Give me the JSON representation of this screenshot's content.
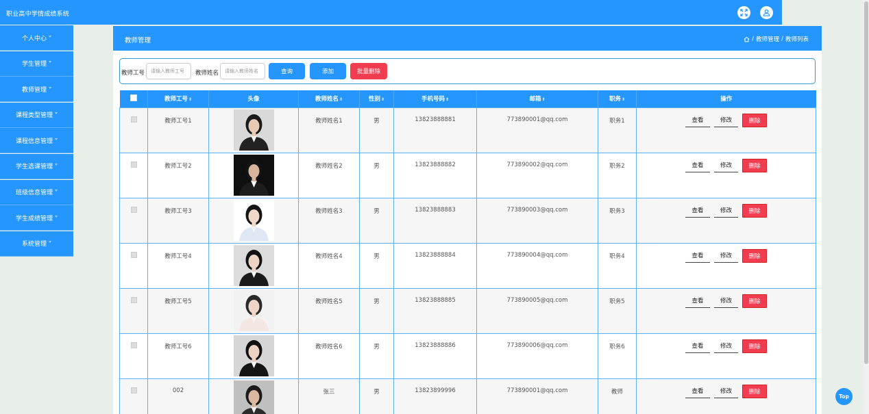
{
  "app": {
    "title": "职业高中学情成绩系统"
  },
  "sidebar": {
    "items": [
      {
        "label": "个人中心"
      },
      {
        "label": "学生管理"
      },
      {
        "label": "教师管理"
      },
      {
        "label": "课程类型管理"
      },
      {
        "label": "课程信息管理"
      },
      {
        "label": "学生选课管理"
      },
      {
        "label": "班级信息管理"
      },
      {
        "label": "学生成绩管理"
      },
      {
        "label": "系统管理"
      }
    ]
  },
  "page": {
    "title": "教师管理",
    "breadcrumb": [
      "教师管理",
      "教师列表"
    ],
    "breadcrumb_sep": "/"
  },
  "search": {
    "teacher_no_label": "教师工号",
    "teacher_no_placeholder": "请输入教师工号",
    "teacher_name_label": "教师姓名",
    "teacher_name_placeholder": "请输入教师姓名",
    "query_label": "查询",
    "add_label": "添加",
    "batch_delete_label": "批量删除"
  },
  "table": {
    "headers": [
      "",
      "教师工号",
      "头像",
      "教师姓名",
      "性别",
      "手机号码",
      "邮箱",
      "职务",
      "操作"
    ],
    "sortable": [
      false,
      true,
      false,
      true,
      true,
      true,
      true,
      true,
      false
    ],
    "sort_glyph": "⇕",
    "rows": [
      {
        "no": "教师工号1",
        "name": "教师姓名1",
        "gender": "男",
        "phone": "13823888881",
        "email": "773890001@qq.com",
        "duty": "职务1",
        "avatar": {
          "bg": "#d9d9d9",
          "suit": "#222222",
          "hair": "#1a1a1a",
          "skin": "#e8c9b4"
        }
      },
      {
        "no": "教师工号2",
        "name": "教师姓名2",
        "gender": "男",
        "phone": "13823888882",
        "email": "773890002@qq.com",
        "duty": "职务2",
        "avatar": {
          "bg": "#0f0f0f",
          "suit": "#1c1c1c",
          "hair": "#141414",
          "skin": "#d8b59c"
        }
      },
      {
        "no": "教师工号3",
        "name": "教师姓名3",
        "gender": "男",
        "phone": "13823888883",
        "email": "773890003@qq.com",
        "duty": "职务3",
        "avatar": {
          "bg": "#ffffff",
          "suit": "#dfe7f5",
          "hair": "#151515",
          "skin": "#f1d8c8"
        }
      },
      {
        "no": "教师工号4",
        "name": "教师姓名4",
        "gender": "男",
        "phone": "13823888884",
        "email": "773890004@qq.com",
        "duty": "职务4",
        "avatar": {
          "bg": "#dcdcdc",
          "suit": "#1a1a1a",
          "hair": "#111111",
          "skin": "#ecd3c3"
        }
      },
      {
        "no": "教师工号5",
        "name": "教师姓名5",
        "gender": "男",
        "phone": "13823888885",
        "email": "773890005@qq.com",
        "duty": "职务5",
        "avatar": {
          "bg": "#f2f2f2",
          "suit": "#f3e6e3",
          "hair": "#2a2a2a",
          "skin": "#efd6c8"
        }
      },
      {
        "no": "教师工号6",
        "name": "教师姓名6",
        "gender": "男",
        "phone": "13823888886",
        "email": "773890006@qq.com",
        "duty": "职务6",
        "avatar": {
          "bg": "#d6d6d6",
          "suit": "#151515",
          "hair": "#101010",
          "skin": "#ecd2c1"
        }
      },
      {
        "no": "002",
        "name": "张三",
        "gender": "男",
        "phone": "13823899996",
        "email": "773890001@qq.com",
        "duty": "教师",
        "avatar": {
          "bg": "#bfbfbf",
          "suit": "#2b2b2b",
          "hair": "#1b1b1b",
          "skin": "#dcb8a0"
        }
      }
    ],
    "actions": {
      "view": "查看",
      "edit": "修改",
      "delete": "删除"
    }
  },
  "back_to_top": "Top",
  "colors": {
    "primary": "#2596fd",
    "danger": "#f23c4f",
    "page_bg": "#e8efe9"
  }
}
